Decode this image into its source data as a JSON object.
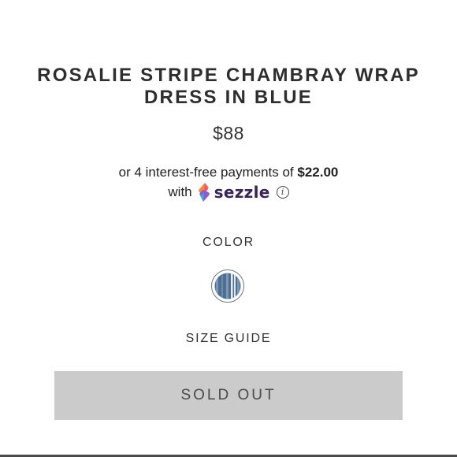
{
  "product": {
    "title_line1": "ROSALIE STRIPE CHAMBRAY WRAP",
    "title_line2": "DRESS IN BLUE",
    "price": "$88"
  },
  "financing": {
    "prefix": "or 4 interest-free payments of",
    "amount": "$22.00",
    "with_text": "with",
    "provider": "sezzle",
    "info_icon": "info-circle-icon",
    "logo_colors": [
      "#f7a340",
      "#e94e86",
      "#8c5cd0",
      "#2fb6c8"
    ]
  },
  "color": {
    "label": "COLOR",
    "swatch_icon": "blue-stripe-swatch",
    "swatch_colors": [
      "#4f6f92",
      "#7b98b4",
      "#e9eef3"
    ]
  },
  "size_guide_label": "SIZE GUIDE",
  "cta": {
    "label": "SOLD OUT",
    "background": "#cbcbcb"
  }
}
